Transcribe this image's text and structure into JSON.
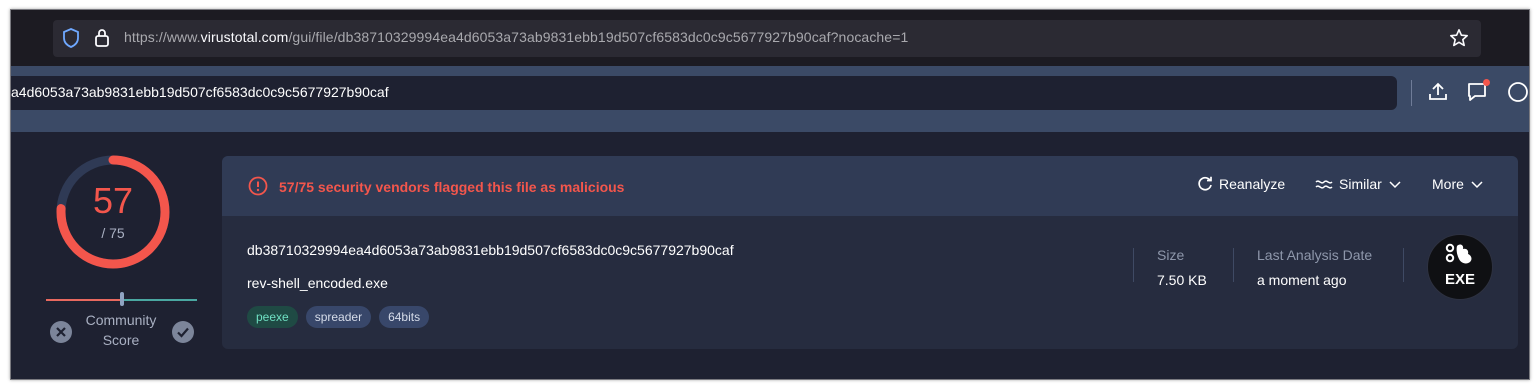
{
  "browser": {
    "url_prefix": "https://www.",
    "url_domain": "virustotal.com",
    "url_path": "/gui/file/db38710329994ea4d6053a73ab9831ebb19d507cf6583dc0c9c5677927b90caf?nocache=1"
  },
  "header": {
    "search_value": "a4d6053a73ab9831ebb19d507cf6583dc0c9c5677927b90caf"
  },
  "score": {
    "detections": "57",
    "total": "/ 75",
    "community_label_line1": "Community",
    "community_label_line2": "Score",
    "ratio": 0.76
  },
  "alert": {
    "text": "57/75 security vendors flagged this file as malicious"
  },
  "actions": {
    "reanalyze": "Reanalyze",
    "similar": "Similar",
    "more": "More"
  },
  "file": {
    "hash": "db38710329994ea4d6053a73ab9831ebb19d507cf6583dc0c9c5677927b90caf",
    "name": "rev-shell_encoded.exe",
    "tags": [
      "peexe",
      "spreader",
      "64bits"
    ]
  },
  "meta": {
    "size_label": "Size",
    "size_value": "7.50 KB",
    "date_label": "Last Analysis Date",
    "date_value": "a moment ago"
  },
  "badge": {
    "type": "EXE"
  },
  "colors": {
    "malicious": "#f3564c",
    "header_bg": "#3b4a66",
    "page_bg": "#1e2131"
  }
}
